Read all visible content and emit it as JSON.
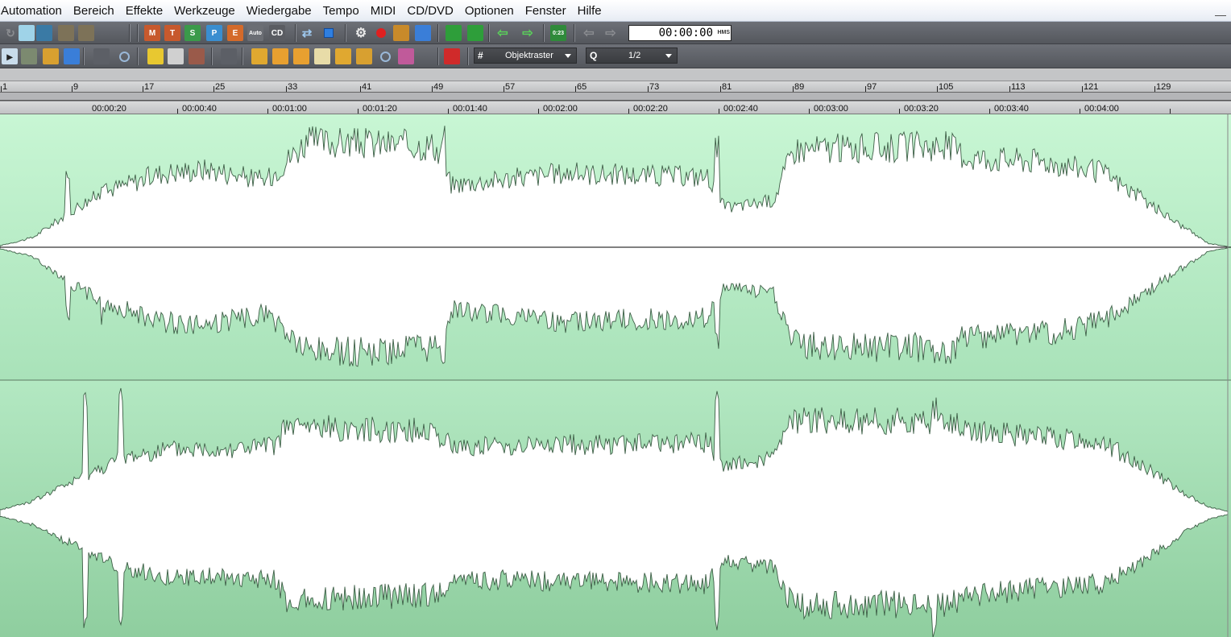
{
  "menu": [
    "Automation",
    "Bereich",
    "Effekte",
    "Werkzeuge",
    "Wiedergabe",
    "Tempo",
    "MIDI",
    "CD/DVD",
    "Optionen",
    "Fenster",
    "Hilfe"
  ],
  "toolbar1": {
    "buttons": [
      {
        "name": "undo-icon",
        "label": ""
      },
      {
        "name": "crossfade-icon",
        "label": ""
      },
      {
        "name": "shuffle-icon",
        "label": ""
      },
      {
        "name": "grid-view-icon",
        "label": ""
      },
      {
        "name": "list-view-icon",
        "label": ""
      },
      {
        "name": "marker-m-icon",
        "label": "M"
      },
      {
        "name": "marker-t-icon",
        "label": "T"
      },
      {
        "name": "marker-s-icon",
        "label": "S"
      },
      {
        "name": "marker-p-icon",
        "label": "P"
      },
      {
        "name": "marker-e-icon",
        "label": "E"
      },
      {
        "name": "auto-marker-icon",
        "label": "Auto"
      },
      {
        "name": "cd-icon",
        "label": "CD"
      },
      {
        "name": "loop-icon",
        "label": ""
      },
      {
        "name": "stop-icon",
        "label": ""
      },
      {
        "name": "settings-gear-icon",
        "label": ""
      },
      {
        "name": "record-icon",
        "label": ""
      },
      {
        "name": "mixer-icon",
        "label": ""
      },
      {
        "name": "equalizer-icon",
        "label": ""
      },
      {
        "name": "flag-start-icon",
        "label": ""
      },
      {
        "name": "flag-end-icon",
        "label": ""
      },
      {
        "name": "arrow-left-icon",
        "label": ""
      },
      {
        "name": "arrow-right-icon",
        "label": ""
      },
      {
        "name": "counter-icon",
        "label": "0:23"
      },
      {
        "name": "nav-back-icon",
        "label": ""
      },
      {
        "name": "nav-forward-icon",
        "label": ""
      }
    ],
    "time_display": "00:00:00",
    "time_unit": "HMS"
  },
  "toolbar2": {
    "buttons": [
      {
        "name": "pointer-tool-icon"
      },
      {
        "name": "multi-track-tool-icon"
      },
      {
        "name": "range-tool-icon"
      },
      {
        "name": "curve-tool-icon"
      },
      {
        "name": "cut-tool-icon"
      },
      {
        "name": "zoom-tool-icon"
      },
      {
        "name": "pencil-tool-icon"
      },
      {
        "name": "brush-tool-icon"
      },
      {
        "name": "eraser-tool-icon"
      },
      {
        "name": "scrub-tool-icon"
      },
      {
        "name": "lock-icon"
      },
      {
        "name": "object-icon"
      },
      {
        "name": "envelope-icon"
      },
      {
        "name": "snap-icon"
      },
      {
        "name": "trim-icon"
      },
      {
        "name": "stack-icon"
      },
      {
        "name": "magnifier-icon"
      },
      {
        "name": "paint-icon"
      },
      {
        "name": "magnet-icon"
      }
    ],
    "snap_label": "Objektraster",
    "quantize_value": "1/2",
    "quantize_icon": "Q"
  },
  "ruler_bars": [
    "1",
    "9",
    "17",
    "25",
    "33",
    "41",
    "49",
    "57",
    "65",
    "73",
    "81",
    "89",
    "97",
    "105",
    "113",
    "121",
    "129"
  ],
  "ruler_times": [
    "00:00:20",
    "00:00:40",
    "00:01:00",
    "00:01:20",
    "00:01:40",
    "00:02:00",
    "00:02:20",
    "00:02:40",
    "00:03:00",
    "00:03:20",
    "00:03:40",
    "00:04:00"
  ],
  "colors": {
    "wave_top_bg_start": "#c8f6d4",
    "wave_top_bg_end": "#a9e2b9",
    "wave_bottom_bg_start": "#b3e8c2",
    "wave_bottom_bg_end": "#8fce9f",
    "waveform_fill": "#ffffff",
    "waveform_stroke": "#3d5e46"
  }
}
